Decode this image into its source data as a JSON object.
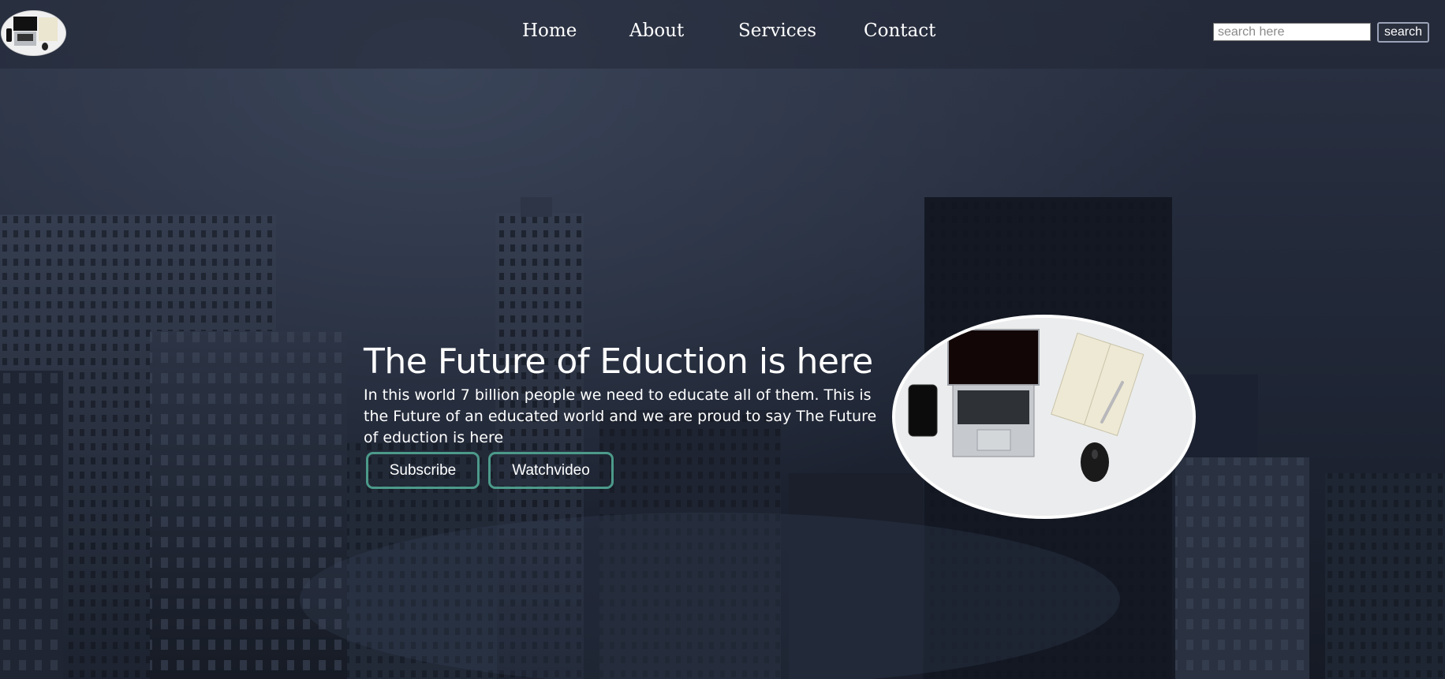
{
  "navbar": {
    "logo_icon": "laptop-desk-logo",
    "links": [
      {
        "label": "Home"
      },
      {
        "label": "About"
      },
      {
        "label": "Services"
      },
      {
        "label": "Contact"
      }
    ],
    "search": {
      "placeholder": "search here",
      "value": "",
      "button_label": "search"
    }
  },
  "hero": {
    "title": "The Future of Eduction is here",
    "text": "In this world 7 billion people we need to educate all of them. This is the Future of an educated world and we are proud to say The Future of eduction is here",
    "buttons": {
      "subscribe": "Subscribe",
      "watch": "Watchvideo"
    },
    "image_icon": "laptop-phone-notebook-mouse-image",
    "accent_color": "#4c9a8a"
  },
  "background": {
    "scene": "night-city-skyline-image"
  }
}
